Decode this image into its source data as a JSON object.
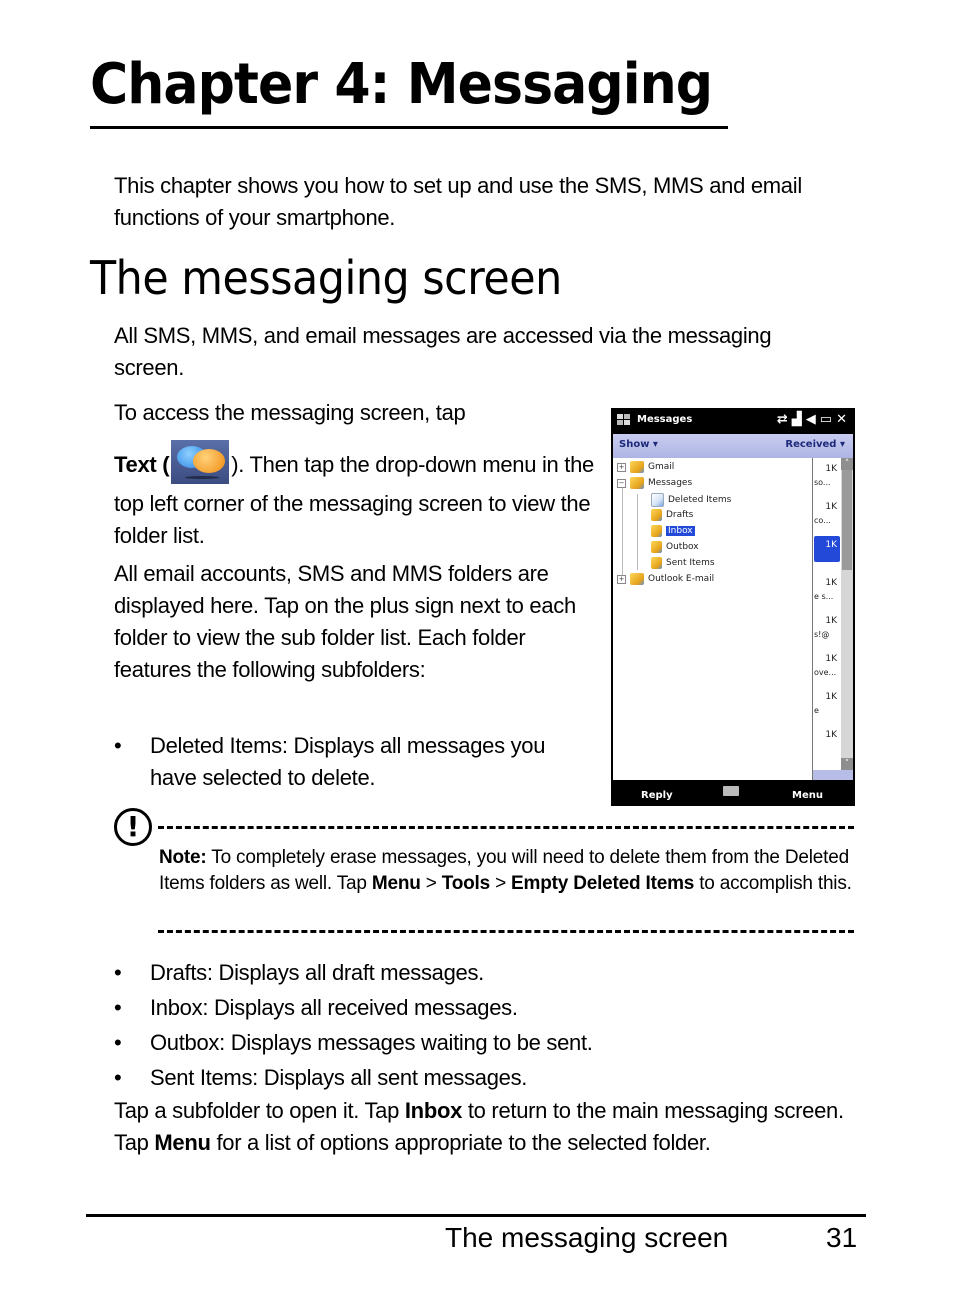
{
  "chapter": {
    "title": "Chapter 4: Messaging",
    "intro": "This chapter shows you how to set up and use the SMS, MMS and email functions of your smartphone."
  },
  "section": {
    "title": "The messaging screen",
    "para1": "All SMS, MMS, and email messages are accessed via the messaging screen.",
    "para2_line1": "To access the messaging screen, tap",
    "para2_text_label": "Text (",
    "para2_after_icon": "). Then tap the drop-down menu in the top left corner of the messaging screen to view the folder list.",
    "para2_icon": "text-messaging-icon",
    "para3": "All email accounts, SMS and MMS folders are displayed here. Tap on the plus sign next to each folder to view the sub folder list. Each folder features the following subfolders:",
    "bullets_top": [
      "Deleted Items: Displays all messages you have selected to delete."
    ],
    "bullets_bottom": [
      "Drafts: Displays all draft messages.",
      "Inbox: Displays all received messages.",
      "Outbox: Displays messages waiting to be sent.",
      "Sent Items: Displays all sent messages."
    ],
    "closing": {
      "t1": "Tap a subfolder to open it. Tap ",
      "b1": "Inbox",
      "t2": " to return to the main messaging screen. Tap ",
      "b2": "Menu",
      "t3": " for a list of options appropriate to the selected folder."
    }
  },
  "note": {
    "label": "Note:",
    "t1": " To completely erase messages, you will need to delete them from the Deleted Items folders as well. Tap ",
    "b1": "Menu",
    "t2": " > ",
    "b2": "Tools",
    "t3": " > ",
    "b3": "Empty Deleted Items",
    "t4": " to accomplish this."
  },
  "phone": {
    "title": "Messages",
    "status_icons": [
      "sync-icon",
      "signal-icon",
      "volume-icon",
      "battery-icon",
      "close-icon"
    ],
    "show_label": "Show",
    "received_label": "Received",
    "tree": [
      {
        "label": "Gmail",
        "expander": "+",
        "level": 0
      },
      {
        "label": "Messages",
        "expander": "-",
        "level": 0
      },
      {
        "label": "Deleted Items",
        "level": 1
      },
      {
        "label": "Drafts",
        "level": 1
      },
      {
        "label": "Inbox",
        "level": 1,
        "selected": true
      },
      {
        "label": "Outbox",
        "level": 1
      },
      {
        "label": "Sent Items",
        "level": 1
      },
      {
        "label": "Outlook E-mail",
        "expander": "+",
        "level": 0
      }
    ],
    "list_sizes": [
      "1K",
      "1K",
      "1K",
      "1K",
      "1K",
      "1K",
      "1K",
      "1K"
    ],
    "list_snippets": [
      "so...",
      "co...",
      "",
      "e s...",
      "s!@",
      "ove...",
      "e",
      ""
    ],
    "softkey_left": "Reply",
    "softkey_right": "Menu",
    "colors": {
      "selected": "#2249d8",
      "menubar": "#aeb4e4",
      "menubar_text": "#1d2a7a"
    }
  },
  "footer": {
    "section": "The messaging screen",
    "page": "31"
  }
}
